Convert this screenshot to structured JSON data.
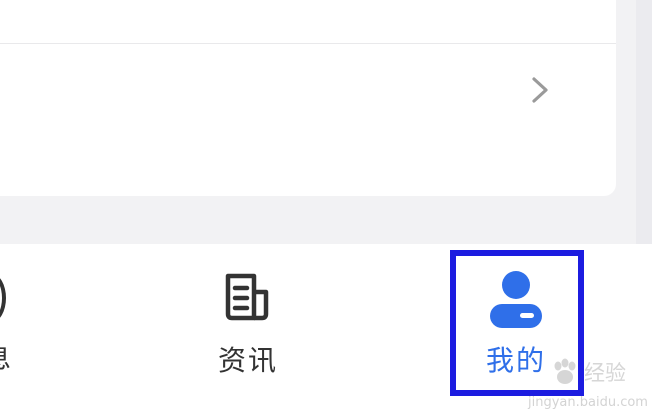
{
  "tabbar": {
    "tabs": [
      {
        "label": "息",
        "icon": "partial-circle-icon",
        "active": false
      },
      {
        "label": "资讯",
        "icon": "news-document-icon",
        "active": false
      },
      {
        "label": "我的",
        "icon": "profile-icon",
        "active": true
      }
    ]
  },
  "colors": {
    "active": "#2f6fe9",
    "inactive": "#333333",
    "highlight_box": "#1c1ce0",
    "content_bg": "#f2f2f4"
  },
  "watermark": {
    "text": "经验",
    "url": "jingyan.baidu.com"
  }
}
